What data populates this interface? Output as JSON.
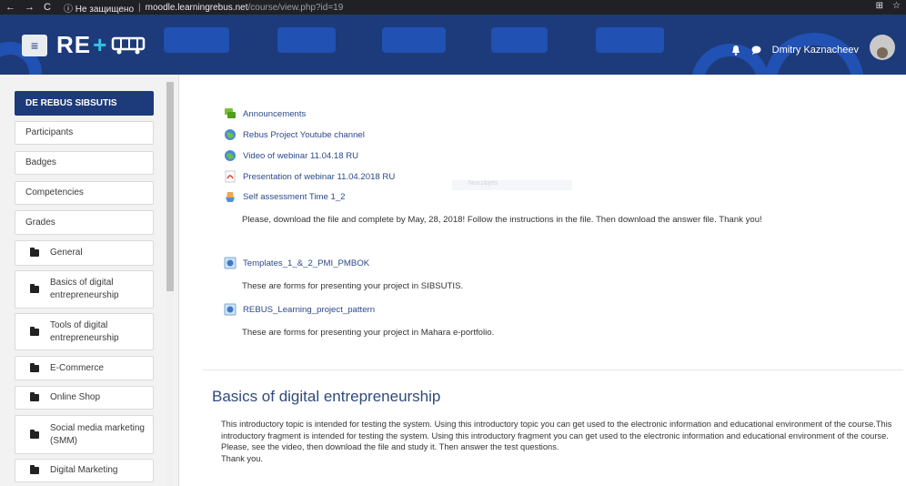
{
  "browser": {
    "back": "←",
    "forward": "→",
    "reload": "C",
    "security_text": "ⓘ Не защищено",
    "host": "moodle.learningrebus.net",
    "path": "/course/view.php?id=19",
    "right_icons": [
      "⊞",
      "☆"
    ]
  },
  "header": {
    "menu_glyph": "≡",
    "logo_text": "RE",
    "logo_plus": "+",
    "user_name": "Dmitry Kaznacheev",
    "bell_glyph": "🔔",
    "chat_glyph": "💬"
  },
  "sidebar": {
    "items": [
      {
        "label": "DE REBUS SIBSUTIS",
        "active": true
      },
      {
        "label": "Participants"
      },
      {
        "label": "Badges"
      },
      {
        "label": "Competencies"
      },
      {
        "label": "Grades"
      },
      {
        "label": "General",
        "folder": true
      },
      {
        "label": "Basics of digital entrepreneurship",
        "folder": true
      },
      {
        "label": "Tools of digital entrepreneurship",
        "folder": true
      },
      {
        "label": "E-Commerce",
        "folder": true
      },
      {
        "label": "Online Shop",
        "folder": true
      },
      {
        "label": "Social media marketing (SMM)",
        "folder": true
      },
      {
        "label": "Digital Marketing",
        "folder": true
      }
    ]
  },
  "main": {
    "resources": [
      {
        "label": "Announcements",
        "icon": "forum-icon"
      },
      {
        "label": "Rebus Project Youtube channel",
        "icon": "url-globe-icon"
      },
      {
        "label": "Video of webinar 11.04.18 RU",
        "icon": "url-globe-icon"
      },
      {
        "label": "Presentation of webinar 11.04.2018 RU",
        "icon": "pdf-icon"
      },
      {
        "label": "Self assessment Time 1_2",
        "icon": "assignment-icon"
      },
      {
        "label": "Templates_1_&_2_PMI_PMBOK",
        "icon": "file-icon"
      },
      {
        "label": "REBUS_Learning_project_pattern",
        "icon": "file-icon"
      }
    ],
    "descriptions": {
      "self_assessment": "Please, download the file and complete by May, 28, 2018! Follow the instructions in the file. Then download the answer file. Thank you!",
      "templates": "These are forms for presenting your project in SIBSUTIS.",
      "pattern": "These are forms for presenting your project in Mahara e-portfolio."
    },
    "faint_text": "Nov.pbjets",
    "section_title": "Basics of digital entrepreneurship",
    "section_text": [
      "This introductory topic is intended for testing the system. Using this introductory topic you can get used to the electronic information and educational environment of the course.This introductory fragment is intended for testing the system. Using this introductory fragment you can get used to the electronic information and educational environment of the course.",
      "Please, see the video, then download the file and study it. Then answer the test questions.",
      "Thank you."
    ]
  }
}
